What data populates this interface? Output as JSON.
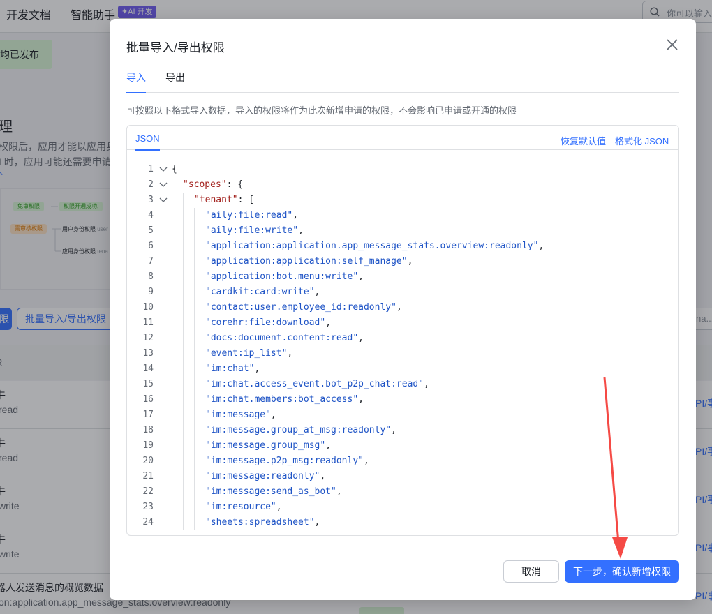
{
  "background": {
    "nav": [
      "开发文档",
      "智能助手"
    ],
    "ai_badge": "AI 开发",
    "search_placeholder": "你可以输入",
    "published": "均已发布",
    "heading": "理",
    "text1": "权限后，应用才能以应用身",
    "text2": "I 时，应用可能还需要申请",
    "diagram": {
      "free_scope": "免审权限",
      "scope_opened": "权限开通成功,",
      "review_scope": "需审核权限",
      "user_identity": "用户身份权限",
      "user_suffix": "user_",
      "app_identity": "应用身份权限",
      "app_suffix": "tena"
    },
    "btn_primary_fragment": "限",
    "batch_button": "批量导入/导出权限",
    "right_input": "na...",
    "table_head": "R",
    "rows": [
      {
        "t1": "牛",
        "t2": "read",
        "t3": "PI/事"
      },
      {
        "t1": "牛",
        "t2": "read",
        "t3": "PI/事"
      },
      {
        "t1": "牛",
        "t2": "write",
        "t3": "PI/事"
      },
      {
        "t1": "牛",
        "t2": "write",
        "t3": "PI/事"
      },
      {
        "t1": "器人发送消息的概览数据",
        "t2": "on:application.app_message_stats.overview:readonly",
        "t3": "PI/事"
      }
    ]
  },
  "modal": {
    "title": "批量导入/导出权限",
    "tabs": [
      "导入",
      "导出"
    ],
    "description": "可按照以下格式导入数据，导入的权限将作为此次新增申请的权限，不会影响已申请或开通的权限",
    "editor_tab": "JSON",
    "restore_default": "恢复默认值",
    "format_json": "格式化 JSON",
    "code_lines": [
      {
        "n": "1",
        "fold": true,
        "text": "{"
      },
      {
        "n": "2",
        "fold": true,
        "key": "\"scopes\"",
        "rest": ": {"
      },
      {
        "n": "3",
        "fold": true,
        "key": "\"tenant\"",
        "rest": ": ["
      },
      {
        "n": "4",
        "value": "\"aily:file:read\"",
        "rest": ","
      },
      {
        "n": "5",
        "value": "\"aily:file:write\"",
        "rest": ","
      },
      {
        "n": "6",
        "value": "\"application:application.app_message_stats.overview:readonly\"",
        "rest": ","
      },
      {
        "n": "7",
        "value": "\"application:application:self_manage\"",
        "rest": ","
      },
      {
        "n": "8",
        "value": "\"application:bot.menu:write\"",
        "rest": ","
      },
      {
        "n": "9",
        "value": "\"cardkit:card:write\"",
        "rest": ","
      },
      {
        "n": "10",
        "value": "\"contact:user.employee_id:readonly\"",
        "rest": ","
      },
      {
        "n": "11",
        "value": "\"corehr:file:download\"",
        "rest": ","
      },
      {
        "n": "12",
        "value": "\"docs:document.content:read\"",
        "rest": ","
      },
      {
        "n": "13",
        "value": "\"event:ip_list\"",
        "rest": ","
      },
      {
        "n": "14",
        "value": "\"im:chat\"",
        "rest": ","
      },
      {
        "n": "15",
        "value": "\"im:chat.access_event.bot_p2p_chat:read\"",
        "rest": ","
      },
      {
        "n": "16",
        "value": "\"im:chat.members:bot_access\"",
        "rest": ","
      },
      {
        "n": "17",
        "value": "\"im:message\"",
        "rest": ","
      },
      {
        "n": "18",
        "value": "\"im:message.group_at_msg:readonly\"",
        "rest": ","
      },
      {
        "n": "19",
        "value": "\"im:message.group_msg\"",
        "rest": ","
      },
      {
        "n": "20",
        "value": "\"im:message.p2p_msg:readonly\"",
        "rest": ","
      },
      {
        "n": "21",
        "value": "\"im:message:readonly\"",
        "rest": ","
      },
      {
        "n": "22",
        "value": "\"im:message:send_as_bot\"",
        "rest": ","
      },
      {
        "n": "23",
        "value": "\"im:resource\"",
        "rest": ","
      },
      {
        "n": "24",
        "value": "\"sheets:spreadsheet\"",
        "rest": ","
      }
    ],
    "cancel": "取消",
    "next": "下一步，确认新增权限"
  },
  "colors": {
    "accent": "#3370ff",
    "annotation_arrow": "#f54a45"
  }
}
